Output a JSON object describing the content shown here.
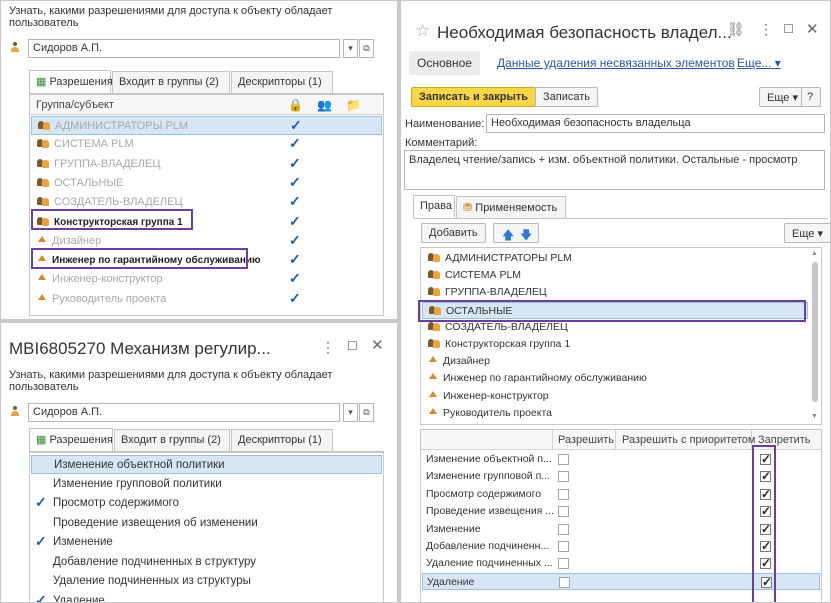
{
  "p1": {
    "caption": "Узнать, какими разрешениями для доступа к объекту обладает пользователь",
    "user": "Сидоров А.П.",
    "tabs": [
      "Разрешения",
      "Входит в группы (2)",
      "Дескрипторы (1)"
    ],
    "col_header": "Группа/субъект",
    "rows": [
      {
        "label": "АДМИНИСТРАТОРЫ PLM",
        "icon": "group",
        "gray": true,
        "check": true
      },
      {
        "label": "СИСТЕМА PLM",
        "icon": "group",
        "gray": true,
        "check": true
      },
      {
        "label": "ГРУППА-ВЛАДЕЛЕЦ",
        "icon": "group",
        "gray": true,
        "check": true
      },
      {
        "label": "ОСТАЛЬНЫЕ",
        "icon": "group",
        "gray": true,
        "check": true
      },
      {
        "label": "СОЗДАТЕЛЬ-ВЛАДЕЛЕЦ",
        "icon": "group",
        "gray": true,
        "check": true
      },
      {
        "label": "Конструкторская группа 1",
        "icon": "group",
        "gray": false,
        "bold": true,
        "check": true
      },
      {
        "label": "Дизайнер",
        "icon": "tri",
        "gray": true,
        "check": true
      },
      {
        "label": "Инженер по гарантийному обслуживанию",
        "icon": "tri",
        "gray": false,
        "bold": true,
        "check": true
      },
      {
        "label": "Инженер-конструктор",
        "icon": "tri",
        "gray": true,
        "check": true
      },
      {
        "label": "Руководитель проекта",
        "icon": "tri",
        "gray": true,
        "check": true
      }
    ]
  },
  "p2": {
    "title": "MBI6805270 Механизм регулир...",
    "caption": "Узнать, какими разрешениями для доступа к объекту обладает пользователь",
    "user": "Сидоров А.П.",
    "tabs": [
      "Разрешения",
      "Входит в группы (2)",
      "Дескрипторы (1)"
    ],
    "rows": [
      {
        "label": "Изменение объектной политики",
        "check": false
      },
      {
        "label": "Изменение групповой политики",
        "check": false
      },
      {
        "label": "Просмотр содержимого",
        "check": true
      },
      {
        "label": "Проведение извещения об изменении",
        "check": false
      },
      {
        "label": "Изменение",
        "check": true
      },
      {
        "label": "Добавление подчиненных в структуру",
        "check": false
      },
      {
        "label": "Удаление подчиненных из структуры",
        "check": false
      },
      {
        "label": "Удаление",
        "check": true
      }
    ]
  },
  "p3": {
    "title": "Необходимая безопасность владел...",
    "nav": {
      "main": "Основное",
      "link": "Данные удаления несвязанных элементов",
      "more": "Еще..."
    },
    "toolbar": {
      "save_close": "Записать и закрыть",
      "save": "Записать",
      "more": "Еще",
      "help": "?"
    },
    "name_label": "Наименование:",
    "name_value": "Необходимая безопасность владельца",
    "comment_label": "Комментарий:",
    "comment_value": "Владелец чтение/запись + изм. объектной политики. Остальные - просмотр",
    "tabs": [
      "Права",
      "Применяемость"
    ],
    "add": "Добавить",
    "more2": "Еще",
    "groups": [
      {
        "label": "АДМИНИСТРАТОРЫ PLM",
        "icon": "group"
      },
      {
        "label": "СИСТЕМА PLM",
        "icon": "group"
      },
      {
        "label": "ГРУППА-ВЛАДЕЛЕЦ",
        "icon": "group"
      },
      {
        "label": "ОСТАЛЬНЫЕ",
        "icon": "group"
      },
      {
        "label": "СОЗДАТЕЛЬ-ВЛАДЕЛЕЦ",
        "icon": "group"
      },
      {
        "label": "Конструкторская группа 1",
        "icon": "group"
      },
      {
        "label": "Дизайнер",
        "icon": "tri"
      },
      {
        "label": "Инженер по гарантийному обслуживанию",
        "icon": "tri"
      },
      {
        "label": "Инженер-конструктор",
        "icon": "tri"
      },
      {
        "label": "Руководитель проекта",
        "icon": "tri"
      }
    ],
    "perm_headers": [
      "Разрешить",
      "Разрешить с приоритетом",
      "Запретить"
    ],
    "perms": [
      {
        "label": "Изменение объектной п...",
        "allow": false,
        "deny": true
      },
      {
        "label": "Изменение групповой п...",
        "allow": false,
        "deny": true
      },
      {
        "label": "Просмотр содержимого",
        "allow": false,
        "deny": true
      },
      {
        "label": "Проведение извещения ...",
        "allow": false,
        "deny": true
      },
      {
        "label": "Изменение",
        "allow": false,
        "deny": true
      },
      {
        "label": "Добавление подчиненн...",
        "allow": false,
        "deny": true
      },
      {
        "label": "Удаление подчиненных ...",
        "allow": false,
        "deny": true
      },
      {
        "label": "Удаление",
        "allow": false,
        "deny": true
      }
    ]
  },
  "colors": {
    "accent": "#1f5ca8",
    "highlight": "#6b3f9e",
    "selection": "#d6e6f5",
    "primary_button": "#f7d64a"
  }
}
